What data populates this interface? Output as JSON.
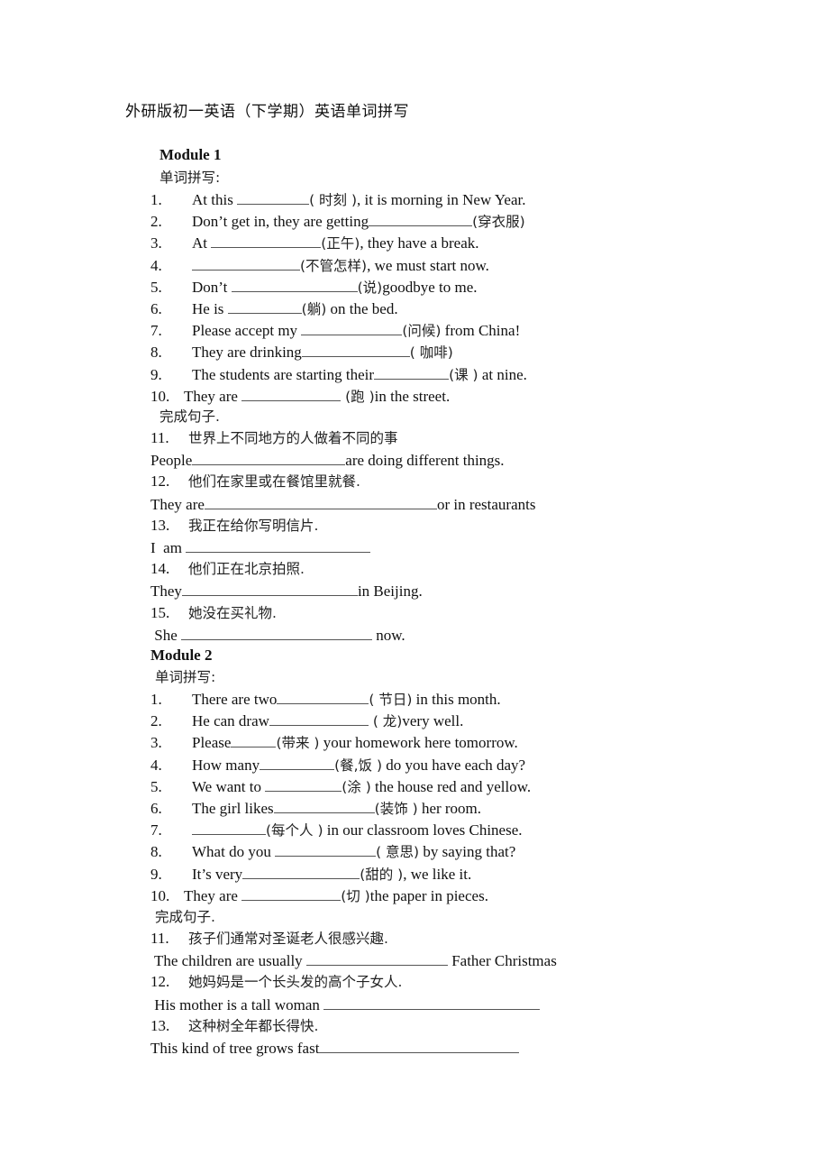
{
  "title": "外研版初一英语（下学期）英语单词拼写",
  "modules": [
    {
      "name": "Module 1",
      "spelling_heading": "单词拼写:",
      "spelling": [
        {
          "num": "1.",
          "before": "At this ",
          "hint": "( 时刻 )",
          "after": ", it is morning in New Year."
        },
        {
          "num": "2.",
          "before": "Don’t get in, they are getting",
          "hint": "(穿衣服)",
          "after": ""
        },
        {
          "num": "3.",
          "before": "At ",
          "hint": "(正午)",
          "after": ", they have a break."
        },
        {
          "num": "4.",
          "before": "",
          "hint": "(不管怎样)",
          "after": ", we must start now."
        },
        {
          "num": "5.",
          "before": "Don’t ",
          "hint": "(说)",
          "after": "goodbye to me."
        },
        {
          "num": "6.",
          "before": "He is ",
          "hint": "(躺)",
          "after": " on the bed."
        },
        {
          "num": "7.",
          "before": "Please accept my ",
          "hint": "(问候)",
          "after": " from China!"
        },
        {
          "num": "8.",
          "before": "They are drinking",
          "hint": "( 咖啡)",
          "after": ""
        },
        {
          "num": "9.",
          "before": "The students are starting their",
          "hint": "(课 )",
          "after": " at nine."
        },
        {
          "num": "10.",
          "before": "They are ",
          "hint": " (跑 )",
          "after": "in the street."
        }
      ],
      "sentence_heading": "完成句子.",
      "sentences": [
        {
          "num": "11.",
          "chinese": "世界上不同地方的人做着不同的事",
          "before": "People",
          "after": "are doing different things."
        },
        {
          "num": "12.",
          "chinese": "他们在家里或在餐馆里就餐.",
          "before": "They are",
          "after": "or in restaurants"
        },
        {
          "num": "13.",
          "chinese": "我正在给你写明信片.",
          "before": "I  am ",
          "after": ""
        },
        {
          "num": "14.",
          "chinese": "他们正在北京拍照.",
          "before": "They",
          "after": "in Beijing."
        },
        {
          "num": "15.",
          "chinese": "她没在买礼物.",
          "before": " She ",
          "after": " now."
        }
      ]
    },
    {
      "name": "Module 2",
      "spelling_heading": "单词拼写:",
      "spelling": [
        {
          "num": "1.",
          "before": "There are two",
          "hint": "( 节日)",
          "after": " in this month."
        },
        {
          "num": "2.",
          "before": "He can draw",
          "hint": " ( 龙)",
          "after": "very well."
        },
        {
          "num": "3.",
          "before": "Please",
          "hint": "(带来 )",
          "after": " your homework here tomorrow."
        },
        {
          "num": "4.",
          "before": "How many",
          "hint": "(餐,饭 )",
          "after": " do you have each day?"
        },
        {
          "num": "5.",
          "before": "We want to ",
          "hint": "(涂 )",
          "after": " the house red and yellow."
        },
        {
          "num": "6.",
          "before": "The girl likes",
          "hint": "(装饰 )",
          "after": " her room."
        },
        {
          "num": "7.",
          "before": "",
          "hint": "(每个人 )",
          "after": " in our classroom loves Chinese."
        },
        {
          "num": "8.",
          "before": "What do you ",
          "hint": "( 意思)",
          "after": " by saying that?"
        },
        {
          "num": "9.",
          "before": "It’s very",
          "hint": "(甜的 )",
          "after": ", we like it."
        },
        {
          "num": "10.",
          "before": "They are ",
          "hint": "(切 )",
          "after": "the paper in pieces."
        }
      ],
      "sentence_heading": "完成句子.",
      "sentences": [
        {
          "num": "11.",
          "chinese": "孩子们通常对圣诞老人很感兴趣.",
          "before": " The children are usually ",
          "after": " Father Christmas"
        },
        {
          "num": "12.",
          "chinese": "她妈妈是一个长头发的高个子女人.",
          "before": " His mother is a tall woman ",
          "after": ""
        },
        {
          "num": "13.",
          "chinese": "这种树全年都长得快.",
          "before": "This kind of tree grows fast",
          "after": ""
        }
      ]
    }
  ]
}
